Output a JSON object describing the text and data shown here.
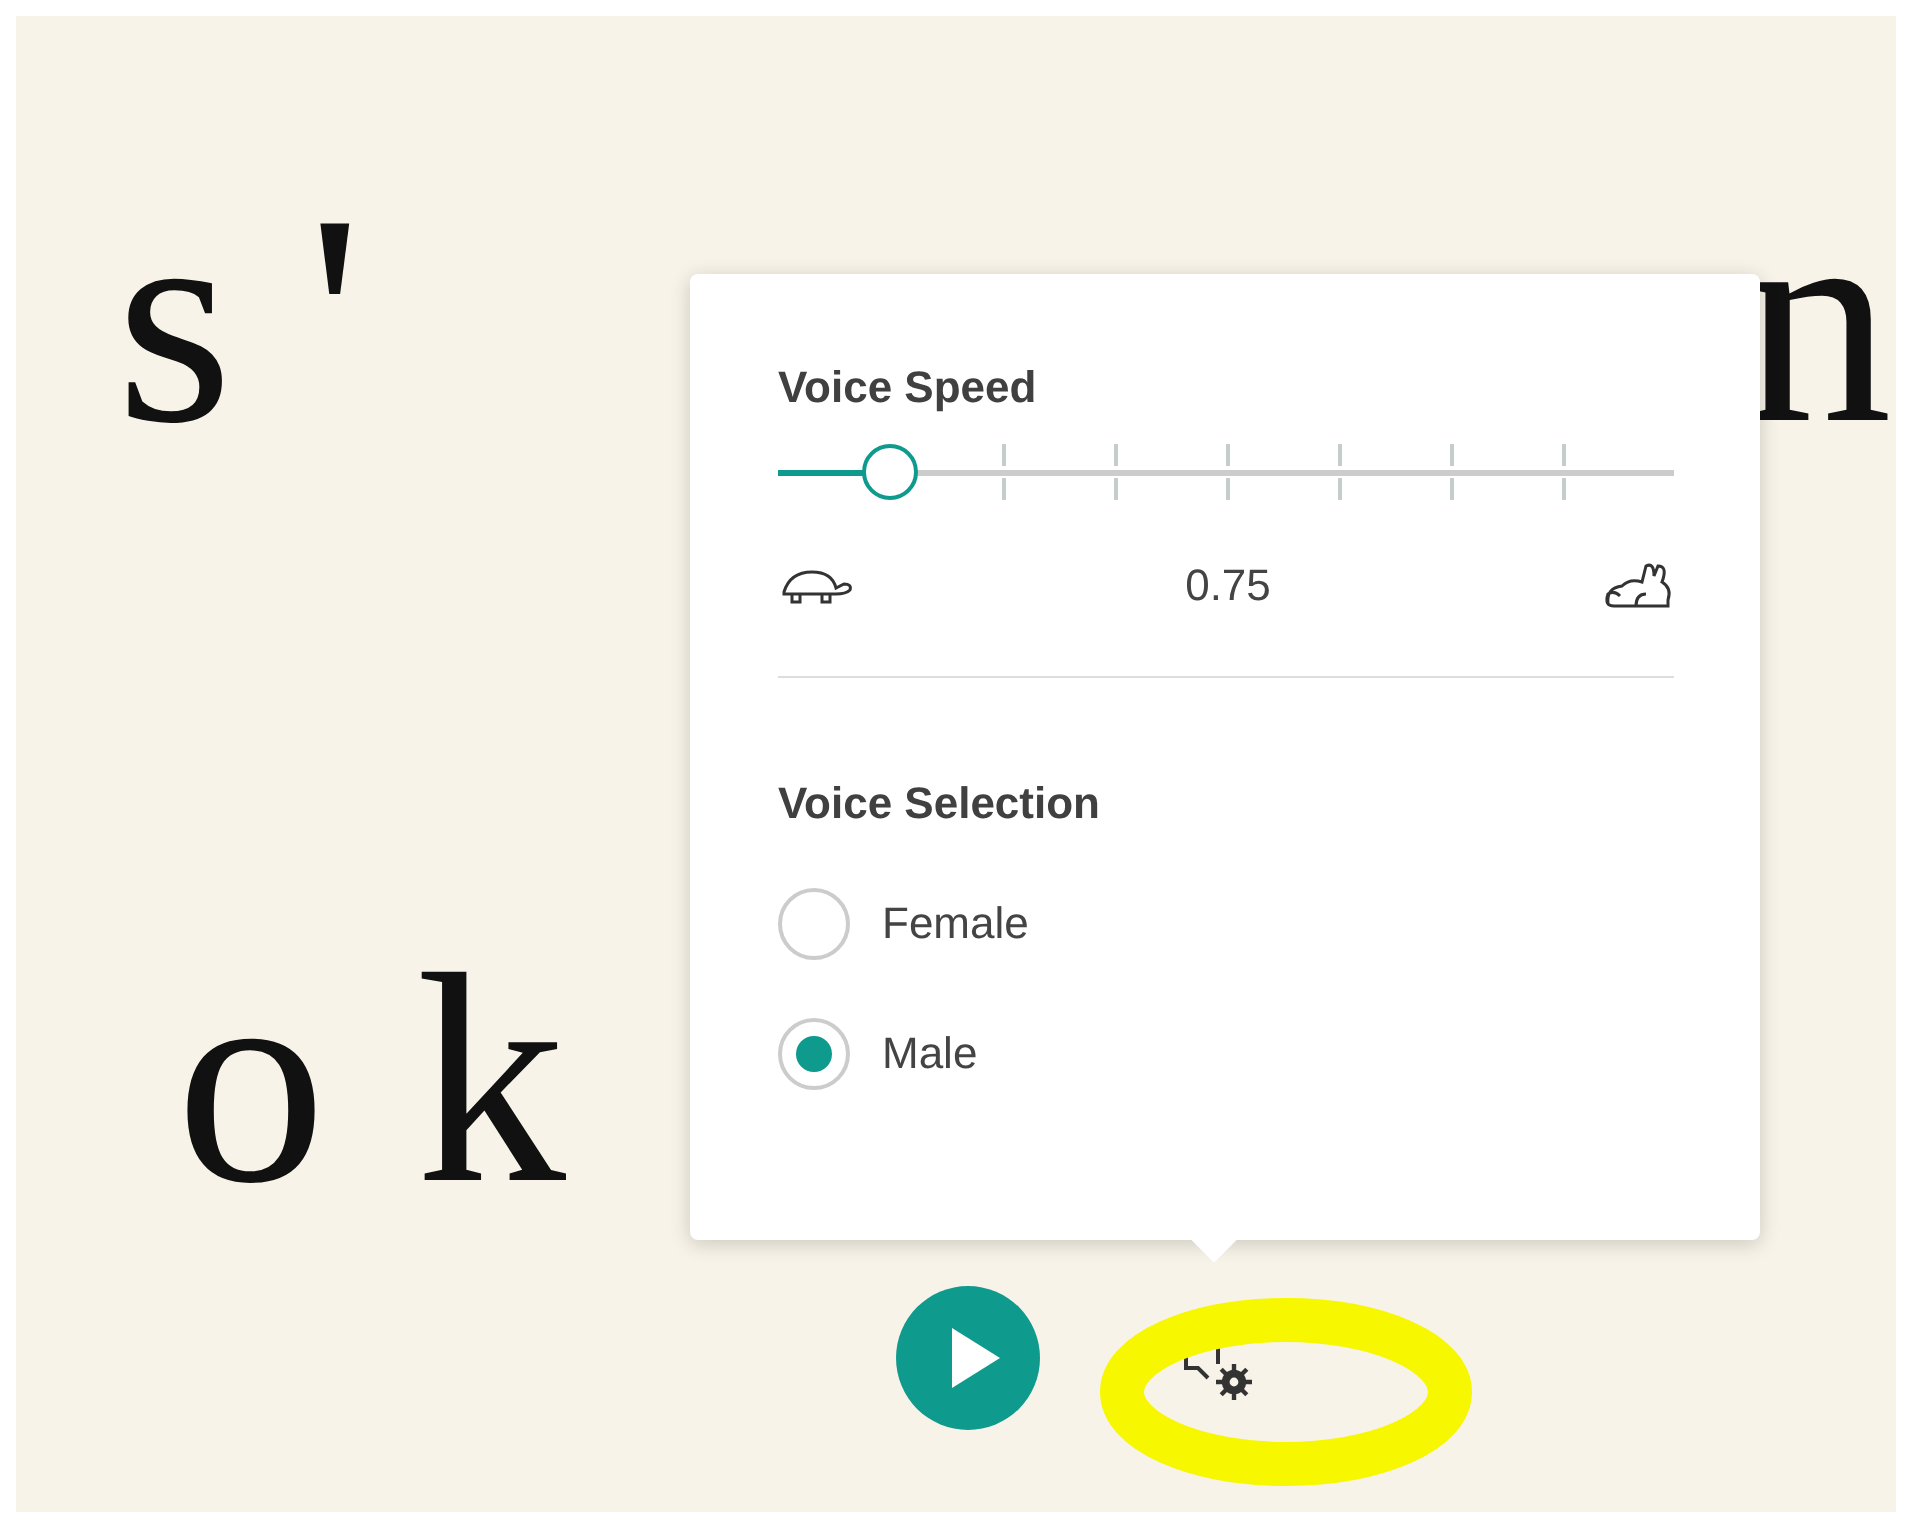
{
  "reading_text": {
    "lines": [
      {
        "left": "s'",
        "right": "n"
      },
      {
        "left": "ok"
      }
    ]
  },
  "voice_speed": {
    "title": "Voice Speed",
    "slider": {
      "level": 0.125
    },
    "reading": "0.75"
  },
  "voice_selection": {
    "title": "Voice Selection",
    "options": [
      {
        "label": "Female",
        "selected": false
      },
      {
        "label": "Male",
        "selected": true
      }
    ]
  }
}
